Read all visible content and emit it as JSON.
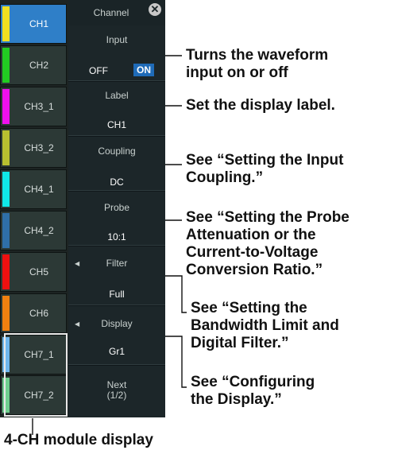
{
  "channels": [
    {
      "label": "CH1",
      "color": "#f0e020"
    },
    {
      "label": "CH2",
      "color": "#22cc22"
    },
    {
      "label": "CH3_1",
      "color": "#ee10ee"
    },
    {
      "label": "CH3_2",
      "color": "#b8c030"
    },
    {
      "label": "CH4_1",
      "color": "#10e8e8"
    },
    {
      "label": "CH4_2",
      "color": "#2f6fa8"
    },
    {
      "label": "CH5",
      "color": "#ee1010"
    },
    {
      "label": "CH6",
      "color": "#f08010"
    },
    {
      "label": "CH7_1",
      "color": "#6fb7ee"
    },
    {
      "label": "CH7_2",
      "color": "#6fcf8f"
    }
  ],
  "menu": {
    "title": "Channel",
    "close_icon": "close-icon",
    "input": {
      "name": "Input",
      "off": "OFF",
      "on": "ON"
    },
    "label": {
      "name": "Label",
      "value": "CH1"
    },
    "coupling": {
      "name": "Coupling",
      "value": "DC"
    },
    "probe": {
      "name": "Probe",
      "value": "10:1"
    },
    "filter": {
      "name": "Filter",
      "value": "Full"
    },
    "display": {
      "name": "Display",
      "value": "Gr1"
    },
    "next": "Next\n(1/2)"
  },
  "callouts": {
    "input": "Turns the waveform\ninput on or off",
    "label": "Set the display label.",
    "coupling": "See “Setting the Input\nCoupling.”",
    "probe": "See “Setting the Probe\nAttenuation or the\nCurrent-to-Voltage\nConversion Ratio.”",
    "filter": "See “Setting the\nBandwidth Limit and\nDigital Filter.”",
    "display": "See “Configuring\nthe Display.”",
    "module": "4-CH module display"
  }
}
